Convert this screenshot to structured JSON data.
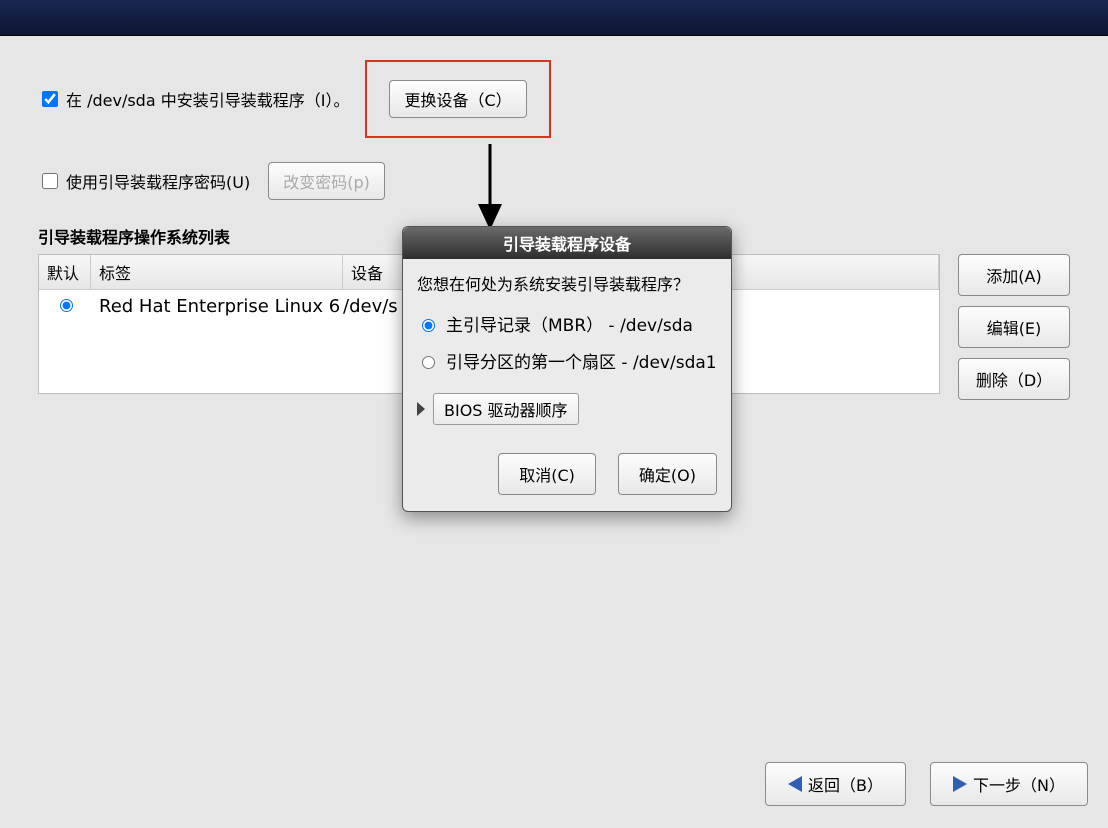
{
  "install_checkbox_label": "在 /dev/sda 中安装引导装载程序（I）。",
  "change_device_btn": "更换设备（C）",
  "use_password_label": "使用引导装载程序密码(U)",
  "change_password_btn": "改变密码(p)",
  "os_list_title": "引导装载程序操作系统列表",
  "table": {
    "headers": {
      "default": "默认",
      "label": "标签",
      "device": "设备"
    },
    "rows": [
      {
        "default_selected": true,
        "label": "Red Hat Enterprise Linux 6",
        "device": "/dev/s"
      }
    ]
  },
  "side_buttons": {
    "add": "添加(A)",
    "edit": "编辑(E)",
    "delete": "删除（D）"
  },
  "dialog": {
    "title": "引导装载程序设备",
    "question": "您想在何处为系统安装引导装载程序？",
    "options": [
      {
        "label": "主引导记录（MBR） - /dev/sda",
        "selected": true
      },
      {
        "label": "引导分区的第一个扇区 - /dev/sda1",
        "selected": false
      }
    ],
    "expander": "BIOS 驱动器顺序",
    "cancel": "取消(C)",
    "ok": "确定(O)"
  },
  "footer": {
    "back": "返回（B）",
    "next": "下一步（N）"
  }
}
